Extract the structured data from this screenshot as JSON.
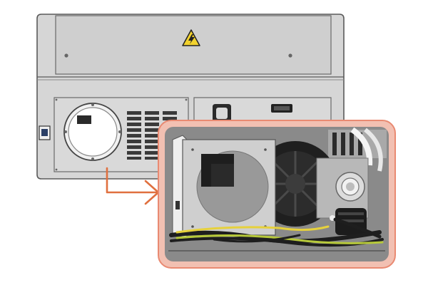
{
  "colors": {
    "background": "#ffffff",
    "housing": "#d4d4d4",
    "housing_outline": "#5a5a5a",
    "callout_border": "#e98a72",
    "callout_fill": "#8a8a8a",
    "arrow": "#e0703f",
    "warning_yellow": "#f2d22e",
    "cable_green": "#b7c93a",
    "cable_yellow": "#e6d13c",
    "cable_black": "#1e1e1e"
  },
  "icons": {
    "warning": "high-voltage-warning-icon",
    "port": "usb-port-icon"
  }
}
